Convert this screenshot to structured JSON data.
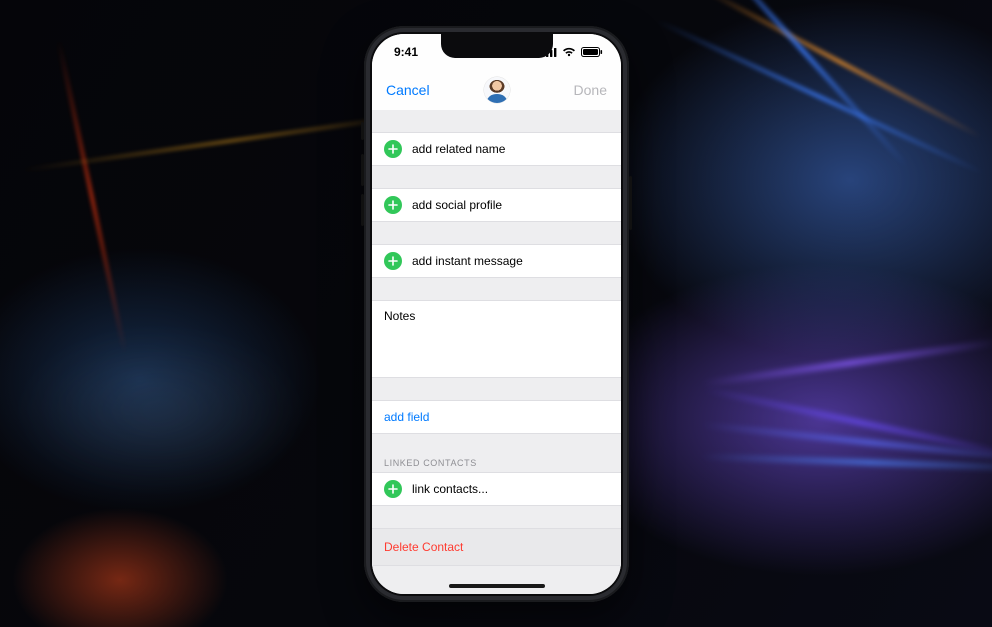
{
  "status": {
    "time": "9:41"
  },
  "nav": {
    "cancel": "Cancel",
    "done": "Done"
  },
  "rows": {
    "related_name": "add related name",
    "social_profile": "add social profile",
    "instant_message": "add instant message",
    "notes_label": "Notes",
    "add_field": "add field",
    "link_contacts": "link contacts...",
    "delete_contact": "Delete Contact"
  },
  "sections": {
    "linked_contacts": "LINKED CONTACTS"
  }
}
